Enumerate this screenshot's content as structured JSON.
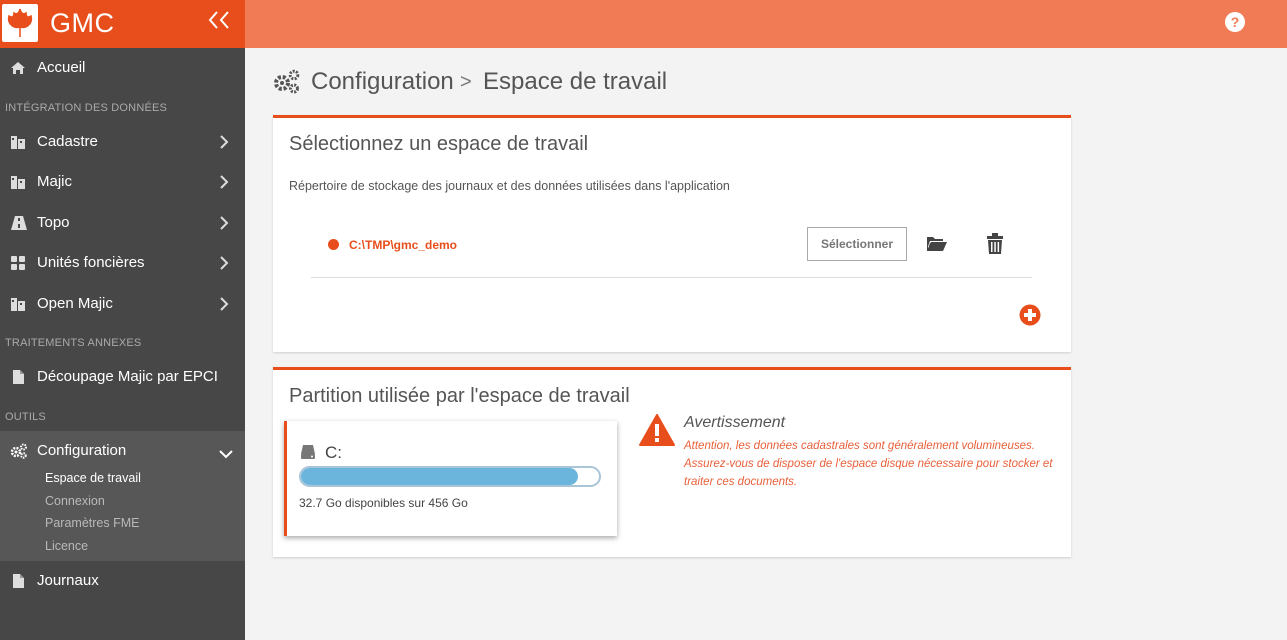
{
  "app": {
    "name": "GMC",
    "brand_color": "#e84e1b",
    "topbar_color": "#f07b54",
    "sidebar_color": "#474747"
  },
  "sidebar": {
    "home": {
      "label": "Accueil",
      "icon": "home-icon"
    },
    "sections": {
      "data_integration": "INTÉGRATION DES DONNÉES",
      "extra_processing": "TRAITEMENTS ANNEXES",
      "tools": "OUTILS"
    },
    "items": [
      {
        "label": "Cadastre",
        "icon": "map-book-icon"
      },
      {
        "label": "Majic",
        "icon": "map-book-icon"
      },
      {
        "label": "Topo",
        "icon": "road-icon"
      },
      {
        "label": "Unités foncières",
        "icon": "grid-icon"
      },
      {
        "label": "Open Majic",
        "icon": "map-book-icon"
      }
    ],
    "decoupage": {
      "label": "Découpage Majic par EPCI",
      "icon": "file-icon"
    },
    "configuration": {
      "label": "Configuration",
      "icon": "gears-icon",
      "expanded": true,
      "subitems": [
        {
          "label": "Espace de travail",
          "active": true
        },
        {
          "label": "Connexion",
          "active": false
        },
        {
          "label": "Paramètres FME",
          "active": false
        },
        {
          "label": "Licence",
          "active": false
        }
      ]
    },
    "journaux": {
      "label": "Journaux",
      "icon": "file-icon"
    }
  },
  "header": {
    "help_label": "?"
  },
  "breadcrumb": {
    "level1": "Configuration",
    "separator": ">",
    "level2": "Espace de travail"
  },
  "workspace_panel": {
    "title": "Sélectionnez un espace de travail",
    "description": "Répertoire de stockage des journaux et des données utilisées dans l'application",
    "workspaces": [
      {
        "path": "C:\\TMP\\gmc_demo",
        "select_label": "Sélectionner"
      }
    ]
  },
  "partition_panel": {
    "title": "Partition utilisée par l'espace de travail",
    "disk": {
      "name": "C:",
      "usage_text": "32.7 Go disponibles sur 456 Go",
      "bar_fill_fraction": 0.93
    },
    "warning": {
      "title": "Avertissement",
      "text": "Attention, les données cadastrales sont généralement volumineuses. Assurez-vous de disposer de l'espace disque nécessaire pour stocker et traiter ces documents."
    }
  }
}
